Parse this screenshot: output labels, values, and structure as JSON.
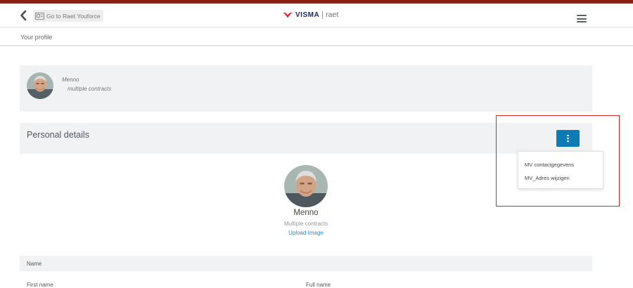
{
  "header": {
    "back_icon": "chevron-left-icon",
    "goto_label": "Go to Raet Youforce",
    "brand": {
      "name": "VISMA",
      "product": "raet",
      "accent_color": "#d9262b"
    },
    "menu_icon": "hamburger-menu-icon",
    "accent_bar_color": "#8a1f14"
  },
  "breadcrumb": {
    "current": "Your profile"
  },
  "profile_card": {
    "name": "Menno",
    "contracts": "multiple contracts"
  },
  "personal_details": {
    "title": "Personal details",
    "actions_icon": "vertical-dots-icon",
    "actions_button_color": "#0d7cb5",
    "menu": [
      {
        "label": "MV contactgegevens"
      },
      {
        "label": "MV_Adres wijzigen"
      }
    ],
    "name": "Menno",
    "contracts": "Multiple contracts",
    "upload_label": "Upload Image"
  },
  "name_section": {
    "title": "Name",
    "fields": [
      {
        "label": "First name"
      },
      {
        "label": "Full name"
      }
    ]
  }
}
